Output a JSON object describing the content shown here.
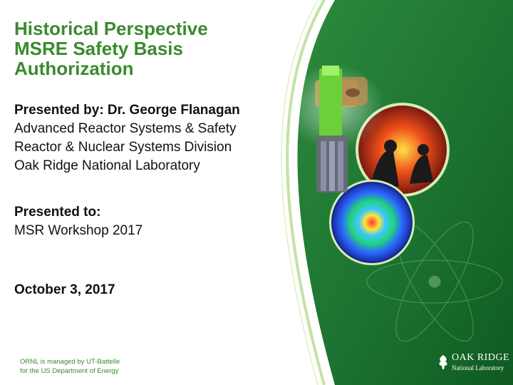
{
  "title_lines": [
    "Historical Perspective",
    "MSRE Safety Basis",
    "Authorization"
  ],
  "presenter": {
    "heading": "Presented by: Dr. George Flanagan",
    "lines": [
      "Advanced Reactor Systems & Safety",
      "Reactor & Nuclear Systems Division",
      "Oak Ridge National Laboratory"
    ]
  },
  "audience": {
    "heading": "Presented to:",
    "value": "MSR Workshop 2017"
  },
  "date": "October 3, 2017",
  "footer": [
    "ORNL is managed by UT-Battelle",
    "for the US Department of Energy"
  ],
  "logo": {
    "word1": "OAK RIDGE",
    "word2": "National Laboratory"
  },
  "colors": {
    "accent_green": "#3a8a2e",
    "panel_green": "#1f7a33",
    "panel_dark": "#115a24"
  }
}
